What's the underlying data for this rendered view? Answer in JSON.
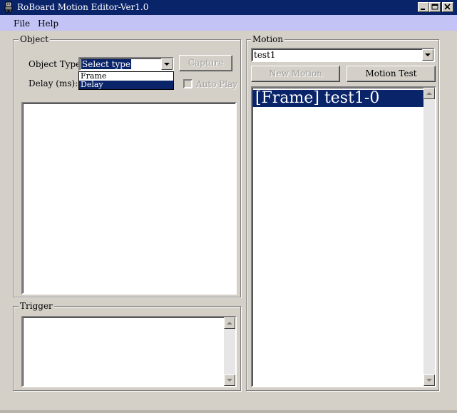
{
  "window": {
    "title": "RoBoard Motion Editor-Ver1.0",
    "controls": [
      "minimize-icon",
      "maximize-icon",
      "close-icon"
    ]
  },
  "menu": {
    "file": "File",
    "help": "Help"
  },
  "object_group": {
    "title": "Object",
    "object_type_label": "Object Type:",
    "object_type_value": "Select type",
    "delay_label": "Delay (ms):",
    "capture_label": "Capture",
    "auto_play_label": "Auto Play",
    "dropdown_options": [
      {
        "label": "Frame",
        "selected": false
      },
      {
        "label": "Delay",
        "selected": true
      }
    ]
  },
  "trigger_group": {
    "title": "Trigger"
  },
  "motion_group": {
    "title": "Motion",
    "selected_motion": "test1",
    "new_motion_label": "New Motion",
    "motion_test_label": "Motion Test",
    "items": [
      "[Frame] test1-0"
    ]
  },
  "colors": {
    "titlebar": "#0a246a",
    "menubar": "#c3c3f5",
    "selection": "#0a246a",
    "face": "#d4d0c8"
  }
}
